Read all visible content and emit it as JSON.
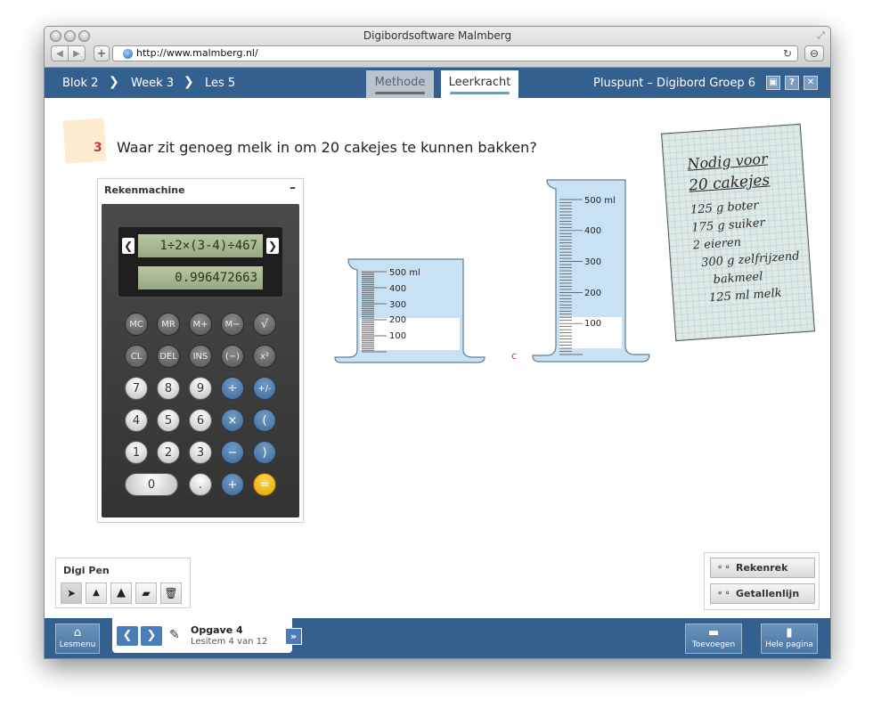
{
  "window": {
    "title": "Digibordsoftware Malmberg"
  },
  "browser": {
    "back_label": "◀",
    "forward_label": "▶",
    "add_label": "+",
    "url": "http://www.malmberg.nl/",
    "reload_label": "↻",
    "reader_label": "⊖"
  },
  "breadcrumb": {
    "items": [
      "Blok 2",
      "Week 3",
      "Les 5"
    ],
    "separator": "❯"
  },
  "tabs": [
    {
      "label": "Methode",
      "active": false
    },
    {
      "label": "Leerkracht",
      "active": true
    }
  ],
  "app": {
    "title": "Pluspunt – Digibord Groep 6",
    "fullscreen_label": "▣",
    "help_label": "?",
    "close_label": "✕"
  },
  "question": {
    "number": "3",
    "text": "Waar zit genoeg melk in om 20 cakejes te kunnen bakken?"
  },
  "calculator": {
    "title": "Rekenmachine",
    "minimize_label": "–",
    "expression": "1÷2×(3-4)÷467",
    "result": "0.996472663",
    "prev_label": "❮",
    "next_label": "❯",
    "rows": [
      [
        "MC",
        "MR",
        "M+",
        "M−",
        "√"
      ],
      [
        "CL",
        "DEL",
        "INS",
        "(−)",
        "x²"
      ],
      [
        "7",
        "8",
        "9",
        "÷",
        "+/-"
      ],
      [
        "4",
        "5",
        "6",
        "×",
        "("
      ],
      [
        "1",
        "2",
        "3",
        "−",
        ")"
      ],
      [
        "0",
        ".",
        "+",
        "="
      ]
    ]
  },
  "beakers": [
    {
      "unit": "ml",
      "ticks": [
        "500 ml",
        "400",
        "300",
        "200",
        "100"
      ],
      "fill_ml": 200,
      "max_ml": 500
    },
    {
      "label": "c",
      "unit": "ml",
      "ticks": [
        "500  ml",
        "400",
        "300",
        "200",
        "100"
      ],
      "fill_ml": 100,
      "max_ml": 500
    }
  ],
  "recipe": {
    "title_line1": "Nodig voor",
    "title_line2": "20 cakejes",
    "items": [
      "125 g boter",
      "175 g suiker",
      "2 eieren",
      "300 g zelfrijzend",
      "bakmeel",
      "125 ml melk"
    ]
  },
  "digipen": {
    "title": "Digi Pen",
    "tools": [
      {
        "name": "pointer",
        "glyph": "➤"
      },
      {
        "name": "pen",
        "glyph": "▲"
      },
      {
        "name": "marker",
        "glyph": "▲"
      },
      {
        "name": "eraser",
        "glyph": "▰"
      },
      {
        "name": "trash",
        "glyph": "🗑"
      }
    ]
  },
  "side_tools": [
    {
      "label": "Rekenrek",
      "icon": "⚬⚬"
    },
    {
      "label": "Getallenlijn",
      "icon": "⚬⚬"
    }
  ],
  "bottom": {
    "lesmenu": "Lesmenu",
    "prev_label": "❮",
    "next_label": "❯",
    "opgave_title": "Opgave 4",
    "opgave_sub": "Lesitem 4 van 12",
    "ff_label": "»",
    "toevoegen": "Toevoegen",
    "hele_pagina": "Hele pagina"
  },
  "colors": {
    "app_bar": "#34608f",
    "accent_red": "#c53a3a",
    "milk_blue": "#bcd9ee"
  }
}
